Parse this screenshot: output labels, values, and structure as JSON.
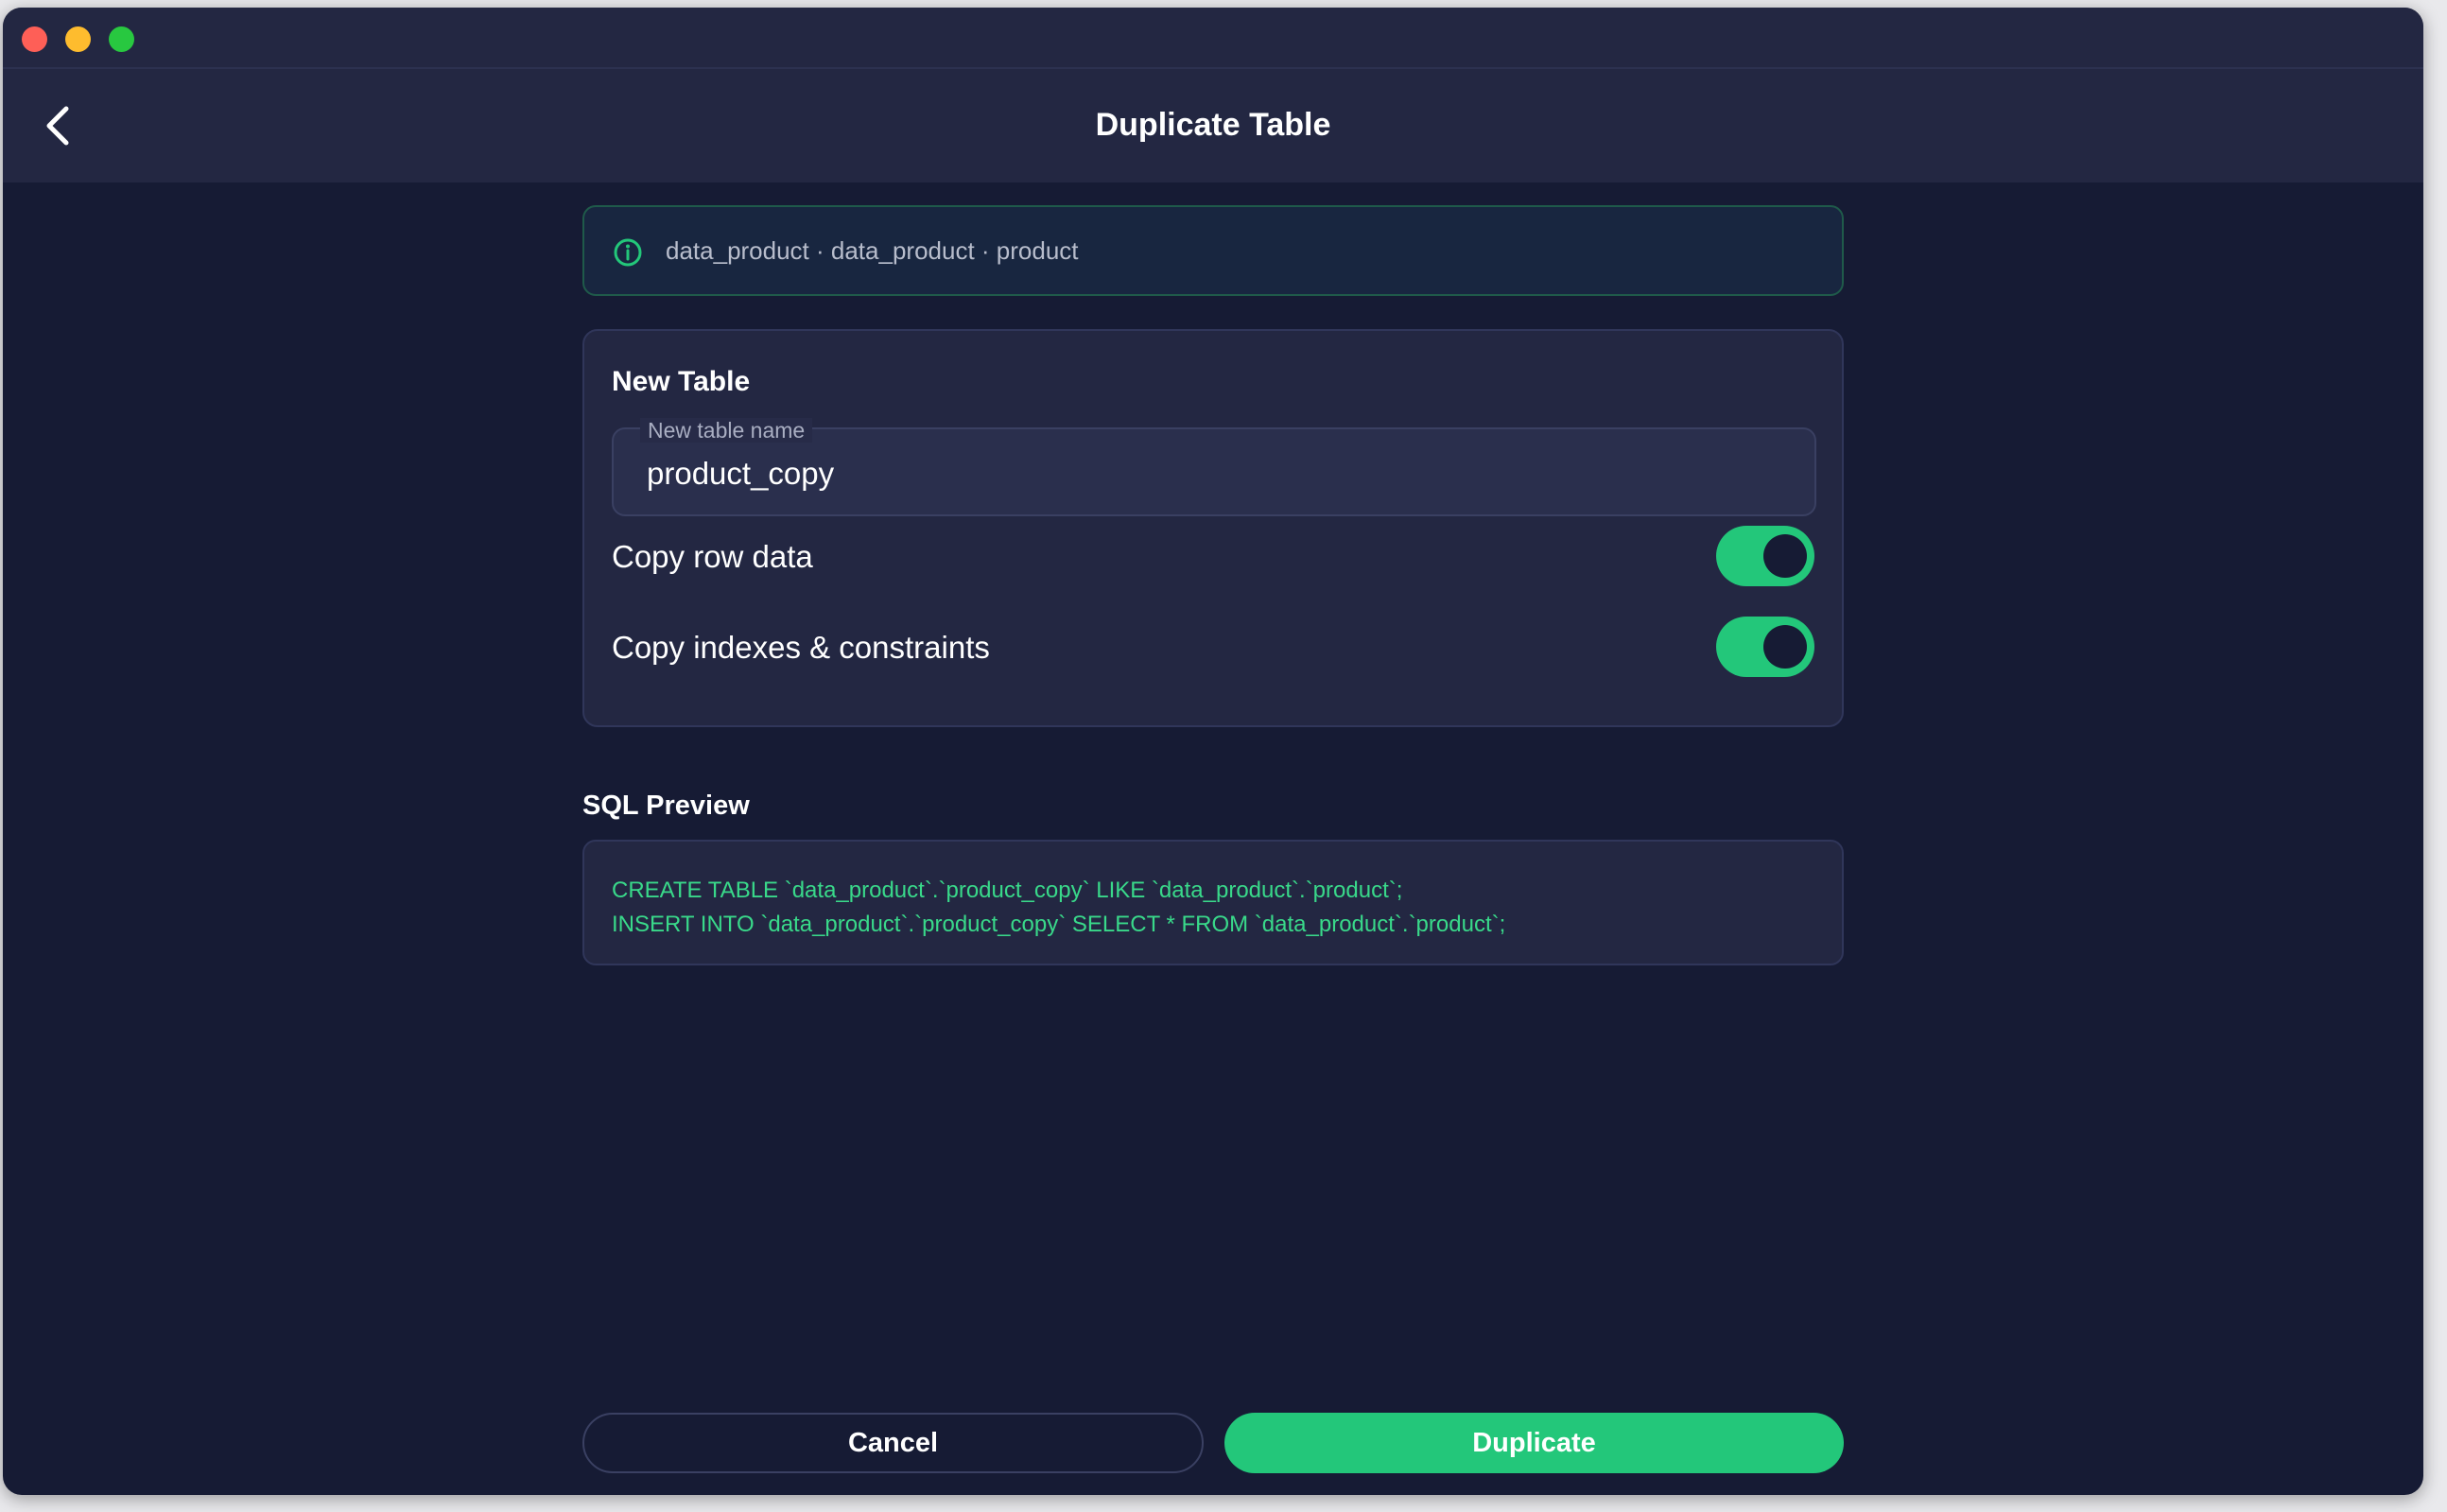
{
  "header": {
    "title": "Duplicate Table"
  },
  "info": {
    "path": "data_product · data_product · product"
  },
  "new_table": {
    "section_title": "New Table",
    "name_label": "New table name",
    "name_value": "product_copy",
    "toggles": [
      {
        "label": "Copy row data",
        "on": true
      },
      {
        "label": "Copy indexes & constraints",
        "on": true
      }
    ]
  },
  "sql_preview": {
    "title": "SQL Preview",
    "lines": [
      "CREATE TABLE `data_product`.`product_copy` LIKE `data_product`.`product`;",
      "INSERT INTO `data_product`.`product_copy` SELECT * FROM `data_product`.`product`;"
    ]
  },
  "actions": {
    "cancel_label": "Cancel",
    "primary_label": "Duplicate"
  },
  "colors": {
    "accent": "#23c77a",
    "background": "#161b34",
    "panel": "#232742",
    "sql_text": "#39d98a"
  },
  "icons": {
    "back": "chevron-left-icon",
    "info": "info-circle-icon"
  }
}
